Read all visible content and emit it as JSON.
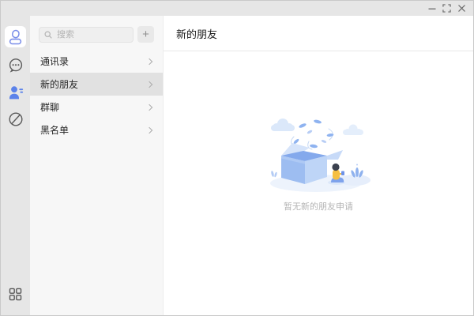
{
  "window": {
    "controls": {
      "minimize_icon": "minimize-icon",
      "maximize_icon": "fullscreen-icon",
      "close_icon": "close-icon"
    }
  },
  "nav_rail": {
    "items": [
      {
        "icon": "profile-avatar-icon",
        "active": true
      },
      {
        "icon": "chat-bubble-icon",
        "active": false
      },
      {
        "icon": "contacts-person-icon",
        "active": true
      },
      {
        "icon": "discover-compass-icon",
        "active": false
      }
    ],
    "bottom_icon": "apps-grid-icon"
  },
  "contacts_panel": {
    "search": {
      "placeholder": "搜索",
      "icon": "search-icon"
    },
    "add_button_label": "+",
    "items": [
      {
        "label": "通讯录",
        "active": false
      },
      {
        "label": "新的朋友",
        "active": true
      },
      {
        "label": "群聊",
        "active": false
      },
      {
        "label": "黑名单",
        "active": false
      }
    ]
  },
  "main": {
    "header_title": "新的朋友",
    "empty_state": {
      "illustration": "empty-open-box-illustration",
      "caption": "暂无新的朋友申请"
    }
  },
  "colors": {
    "accent_blue": "#5b82ea",
    "avatar_outline_blue": "#7a8ee9",
    "rail_bg": "#e6e6e6",
    "panel_bg": "#f7f7f7",
    "active_item_bg": "#e1e1e1",
    "search_box_bg": "#efefef",
    "divider": "#e7e7e7",
    "text_primary": "#262626",
    "text_muted": "#b5b5b5",
    "icon_gray": "#5a5a5a"
  }
}
